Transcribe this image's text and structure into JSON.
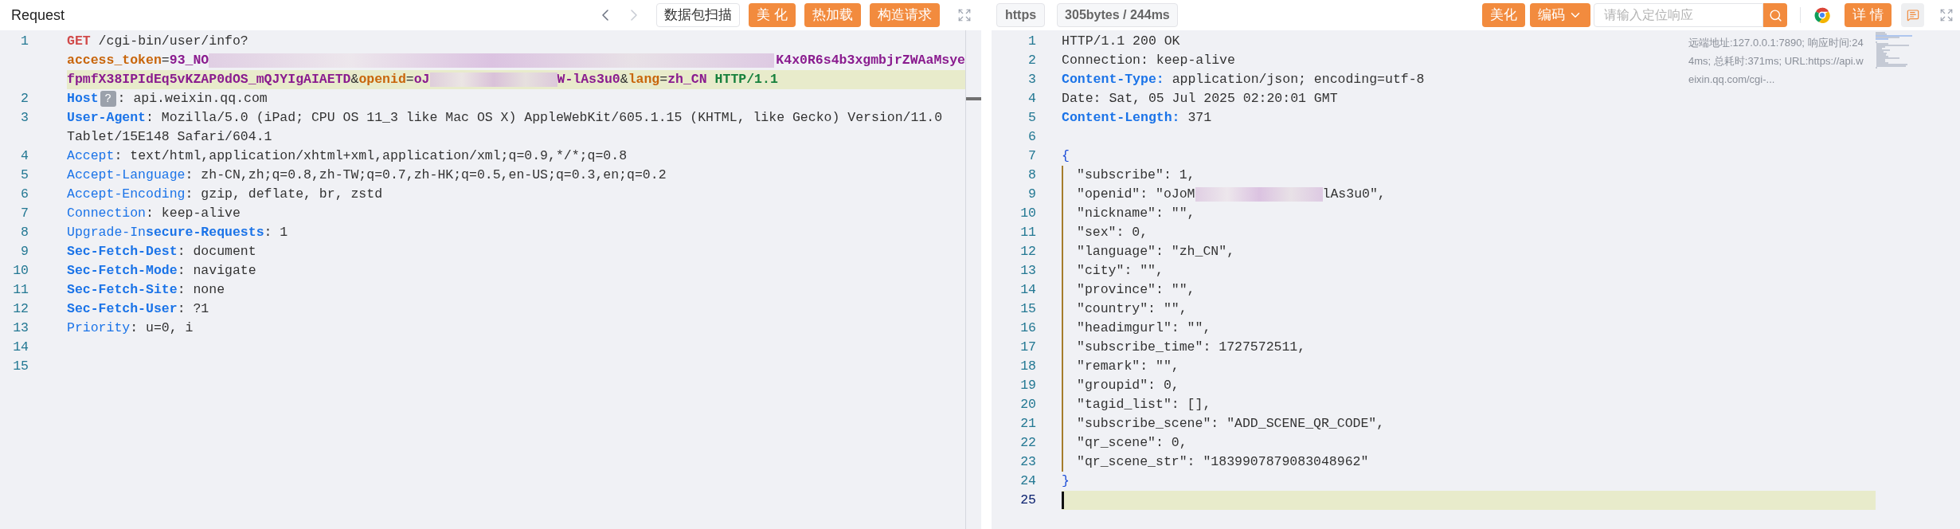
{
  "request": {
    "title": "Request",
    "history_nav": {
      "back_disabled": false,
      "forward_disabled": true
    },
    "buttons": [
      {
        "label": "数据包扫描",
        "kind": "outline"
      },
      {
        "label": "美 化",
        "kind": "primary"
      },
      {
        "label": "热加载",
        "kind": "primary"
      },
      {
        "label": "构造请求",
        "kind": "primary"
      }
    ],
    "lines": [
      {
        "number": "1",
        "rows": [
          {
            "highlighted": false,
            "cursor": false,
            "segments": [
              {
                "kind": "method",
                "text": "GET"
              },
              {
                "kind": "plain",
                "text": " /cgi-bin/user/info?"
              }
            ]
          },
          {
            "highlighted": false,
            "cursor": false,
            "segments": [
              {
                "kind": "key",
                "text": "access_token"
              },
              {
                "kind": "plain",
                "text": "="
              },
              {
                "kind": "value",
                "text": "93_NO"
              },
              {
                "kind": "redacted",
                "wide": true
              },
              {
                "kind": "value",
                "text": "K4x0R6s4b3xgmbjrZWAaMsye"
              }
            ]
          },
          {
            "highlighted": true,
            "cursor": false,
            "segments": [
              {
                "kind": "value",
                "text": "fpmfX38IPIdEq5vKZAP0dOS_mQJYIgAIAETD"
              },
              {
                "kind": "plain",
                "text": "&"
              },
              {
                "kind": "key",
                "text": "openid"
              },
              {
                "kind": "plain",
                "text": "="
              },
              {
                "kind": "value",
                "text": "oJ"
              },
              {
                "kind": "redacted",
                "wide": false
              },
              {
                "kind": "value",
                "text": "W-lAs3u0"
              },
              {
                "kind": "plain",
                "text": "&"
              },
              {
                "kind": "key",
                "text": "lang"
              },
              {
                "kind": "plain",
                "text": "="
              },
              {
                "kind": "value",
                "text": "zh_CN"
              },
              {
                "kind": "proto",
                "text": " HTTP/1.1"
              }
            ]
          }
        ]
      },
      {
        "number": "2",
        "rows": [
          {
            "highlighted": false,
            "cursor": false,
            "segments": [
              {
                "kind": "header",
                "bold": true,
                "text": "Host"
              },
              {
                "kind": "badge",
                "text": "?"
              },
              {
                "kind": "plain",
                "text": ": api.weixin.qq.com"
              }
            ]
          }
        ]
      },
      {
        "number": "3",
        "rows": [
          {
            "highlighted": false,
            "cursor": false,
            "segments": [
              {
                "kind": "header",
                "bold": true,
                "text": "User-Agent"
              },
              {
                "kind": "plain",
                "text": ": Mozilla/5.0 (iPad; CPU OS 11_3 like Mac OS X) AppleWebKit/605.1.15 (KHTML, like Gecko) Version/11.0"
              }
            ]
          },
          {
            "highlighted": false,
            "cursor": false,
            "segments": [
              {
                "kind": "plain",
                "text": "Tablet/15E148 Safari/604.1"
              }
            ]
          }
        ]
      },
      {
        "number": "4",
        "rows": [
          {
            "highlighted": false,
            "cursor": false,
            "segments": [
              {
                "kind": "header",
                "bold": false,
                "text": "Accept"
              },
              {
                "kind": "plain",
                "text": ": text/html,application/xhtml+xml,application/xml;q=0.9,*/*;q=0.8"
              }
            ]
          }
        ]
      },
      {
        "number": "5",
        "rows": [
          {
            "highlighted": false,
            "cursor": false,
            "segments": [
              {
                "kind": "header",
                "bold": false,
                "text": "Accept-Language"
              },
              {
                "kind": "plain",
                "text": ": zh-CN,zh;q=0.8,zh-TW;q=0.7,zh-HK;q=0.5,en-US;q=0.3,en;q=0.2"
              }
            ]
          }
        ]
      },
      {
        "number": "6",
        "rows": [
          {
            "highlighted": false,
            "cursor": false,
            "segments": [
              {
                "kind": "header",
                "bold": false,
                "text": "Accept-Encoding"
              },
              {
                "kind": "plain",
                "text": ": gzip, deflate, br, zstd"
              }
            ]
          }
        ]
      },
      {
        "number": "7",
        "rows": [
          {
            "highlighted": false,
            "cursor": false,
            "segments": [
              {
                "kind": "header",
                "bold": false,
                "text": "Connection"
              },
              {
                "kind": "plain",
                "text": ": keep-alive"
              }
            ]
          }
        ]
      },
      {
        "number": "8",
        "rows": [
          {
            "highlighted": false,
            "cursor": false,
            "segments": [
              {
                "kind": "header",
                "bold": false,
                "text": "Upgrade-In"
              },
              {
                "kind": "header",
                "bold": true,
                "text": "secure-Requests"
              },
              {
                "kind": "plain",
                "text": ": 1"
              }
            ]
          }
        ]
      },
      {
        "number": "9",
        "rows": [
          {
            "highlighted": false,
            "cursor": false,
            "segments": [
              {
                "kind": "header",
                "bold": true,
                "text": "Sec-Fetch-Dest"
              },
              {
                "kind": "plain",
                "text": ": document"
              }
            ]
          }
        ]
      },
      {
        "number": "10",
        "rows": [
          {
            "highlighted": false,
            "cursor": false,
            "segments": [
              {
                "kind": "header",
                "bold": true,
                "text": "Sec-Fetch-Mode"
              },
              {
                "kind": "plain",
                "text": ": navigate"
              }
            ]
          }
        ]
      },
      {
        "number": "11",
        "rows": [
          {
            "highlighted": false,
            "cursor": false,
            "segments": [
              {
                "kind": "header",
                "bold": true,
                "text": "Sec-Fetch-Site"
              },
              {
                "kind": "plain",
                "text": ": none"
              }
            ]
          }
        ]
      },
      {
        "number": "12",
        "rows": [
          {
            "highlighted": false,
            "cursor": false,
            "segments": [
              {
                "kind": "header",
                "bold": true,
                "text": "Sec-Fetch-User"
              },
              {
                "kind": "plain",
                "text": ": ?1"
              }
            ]
          }
        ]
      },
      {
        "number": "13",
        "rows": [
          {
            "highlighted": false,
            "cursor": false,
            "segments": [
              {
                "kind": "header",
                "bold": false,
                "text": "Priority"
              },
              {
                "kind": "plain",
                "text": ": u=0, i"
              }
            ]
          }
        ]
      },
      {
        "number": "14",
        "rows": [
          {
            "highlighted": false,
            "cursor": false
          }
        ]
      },
      {
        "number": "15",
        "rows": [
          {
            "highlighted": false,
            "cursor": false
          }
        ]
      }
    ]
  },
  "response": {
    "protocol": "https",
    "stats": "305bytes / 244ms",
    "buttons": [
      {
        "label": "美化",
        "kind": "primary"
      },
      {
        "label": "编码",
        "kind": "dropdown"
      }
    ],
    "search": {
      "placeholder": "请输入定位响应"
    },
    "detail_button": "详 情",
    "info": "远端地址:127.0.0.1:7890; 响应时间:244ms; 总耗时:371ms; URL:https://api.weixin.qq.com/cgi-...",
    "lines": [
      {
        "number": "1",
        "rows": [
          {
            "highlighted": false,
            "cursor": false,
            "segments": [
              {
                "kind": "plain",
                "text": "HTTP/1.1 200 OK"
              }
            ]
          }
        ]
      },
      {
        "number": "2",
        "rows": [
          {
            "highlighted": false,
            "cursor": false,
            "segments": [
              {
                "kind": "plain",
                "text": "Connection: keep-alive"
              }
            ]
          }
        ]
      },
      {
        "number": "3",
        "rows": [
          {
            "highlighted": false,
            "cursor": false,
            "segments": [
              {
                "kind": "header",
                "bold": true,
                "text": "Content-Type:"
              },
              {
                "kind": "plain",
                "text": " application/json; encoding=utf-8"
              }
            ]
          }
        ]
      },
      {
        "number": "4",
        "rows": [
          {
            "highlighted": false,
            "cursor": false,
            "segments": [
              {
                "kind": "plain",
                "text": "Date: Sat, 05 Jul 2025 02:20:01 GMT"
              }
            ]
          }
        ]
      },
      {
        "number": "5",
        "rows": [
          {
            "highlighted": false,
            "cursor": false,
            "segments": [
              {
                "kind": "header",
                "bold": true,
                "text": "Content-Length:"
              },
              {
                "kind": "plain",
                "text": " 371"
              }
            ]
          }
        ]
      },
      {
        "number": "6",
        "rows": [
          {
            "highlighted": false,
            "cursor": false
          }
        ]
      },
      {
        "number": "7",
        "rows": [
          {
            "highlighted": false,
            "cursor": false,
            "segments": [
              {
                "kind": "brace",
                "text": "{"
              }
            ]
          }
        ]
      },
      {
        "number": "8",
        "rows": [
          {
            "highlighted": false,
            "cursor": false,
            "segments": [
              {
                "kind": "indent"
              },
              {
                "kind": "plain",
                "text": "\"subscribe\": 1,"
              }
            ]
          }
        ]
      },
      {
        "number": "9",
        "rows": [
          {
            "highlighted": false,
            "cursor": false,
            "segments": [
              {
                "kind": "indent"
              },
              {
                "kind": "plain",
                "text": "\"openid\": \"oJoM"
              },
              {
                "kind": "redacted",
                "wide": false
              },
              {
                "kind": "plain",
                "text": "lAs3u0\","
              }
            ]
          }
        ]
      },
      {
        "number": "10",
        "rows": [
          {
            "highlighted": false,
            "cursor": false,
            "segments": [
              {
                "kind": "indent"
              },
              {
                "kind": "plain",
                "text": "\"nickname\": \"\","
              }
            ]
          }
        ]
      },
      {
        "number": "11",
        "rows": [
          {
            "highlighted": false,
            "cursor": false,
            "segments": [
              {
                "kind": "indent"
              },
              {
                "kind": "plain",
                "text": "\"sex\": 0,"
              }
            ]
          }
        ]
      },
      {
        "number": "12",
        "rows": [
          {
            "highlighted": false,
            "cursor": false,
            "segments": [
              {
                "kind": "indent"
              },
              {
                "kind": "plain",
                "text": "\"language\": \"zh_CN\","
              }
            ]
          }
        ]
      },
      {
        "number": "13",
        "rows": [
          {
            "highlighted": false,
            "cursor": false,
            "segments": [
              {
                "kind": "indent"
              },
              {
                "kind": "plain",
                "text": "\"city\": \"\","
              }
            ]
          }
        ]
      },
      {
        "number": "14",
        "rows": [
          {
            "highlighted": false,
            "cursor": false,
            "segments": [
              {
                "kind": "indent"
              },
              {
                "kind": "plain",
                "text": "\"province\": \"\","
              }
            ]
          }
        ]
      },
      {
        "number": "15",
        "rows": [
          {
            "highlighted": false,
            "cursor": false,
            "segments": [
              {
                "kind": "indent"
              },
              {
                "kind": "plain",
                "text": "\"country\": \"\","
              }
            ]
          }
        ]
      },
      {
        "number": "16",
        "rows": [
          {
            "highlighted": false,
            "cursor": false,
            "segments": [
              {
                "kind": "indent"
              },
              {
                "kind": "plain",
                "text": "\"headimgurl\": \"\","
              }
            ]
          }
        ]
      },
      {
        "number": "17",
        "rows": [
          {
            "highlighted": false,
            "cursor": false,
            "segments": [
              {
                "kind": "indent"
              },
              {
                "kind": "plain",
                "text": "\"subscribe_time\": 1727572511,"
              }
            ]
          }
        ]
      },
      {
        "number": "18",
        "rows": [
          {
            "highlighted": false,
            "cursor": false,
            "segments": [
              {
                "kind": "indent"
              },
              {
                "kind": "plain",
                "text": "\"remark\": \"\","
              }
            ]
          }
        ]
      },
      {
        "number": "19",
        "rows": [
          {
            "highlighted": false,
            "cursor": false,
            "segments": [
              {
                "kind": "indent"
              },
              {
                "kind": "plain",
                "text": "\"groupid\": 0,"
              }
            ]
          }
        ]
      },
      {
        "number": "20",
        "rows": [
          {
            "highlighted": false,
            "cursor": false,
            "segments": [
              {
                "kind": "indent"
              },
              {
                "kind": "plain",
                "text": "\"tagid_list\": [],"
              }
            ]
          }
        ]
      },
      {
        "number": "21",
        "rows": [
          {
            "highlighted": false,
            "cursor": false,
            "segments": [
              {
                "kind": "indent"
              },
              {
                "kind": "plain",
                "text": "\"subscribe_scene\": \"ADD_SCENE_QR_CODE\","
              }
            ]
          }
        ]
      },
      {
        "number": "22",
        "rows": [
          {
            "highlighted": false,
            "cursor": false,
            "segments": [
              {
                "kind": "indent"
              },
              {
                "kind": "plain",
                "text": "\"qr_scene\": 0,"
              }
            ]
          }
        ]
      },
      {
        "number": "23",
        "rows": [
          {
            "highlighted": false,
            "cursor": false,
            "segments": [
              {
                "kind": "indent"
              },
              {
                "kind": "plain",
                "text": "\"qr_scene_str\": \"1839907879083048962\""
              }
            ]
          }
        ]
      },
      {
        "number": "24",
        "rows": [
          {
            "highlighted": false,
            "cursor": false,
            "segments": [
              {
                "kind": "brace",
                "text": "}"
              }
            ]
          }
        ]
      },
      {
        "number": "25",
        "rows": [
          {
            "highlighted": true,
            "cursor": true
          }
        ]
      }
    ]
  }
}
